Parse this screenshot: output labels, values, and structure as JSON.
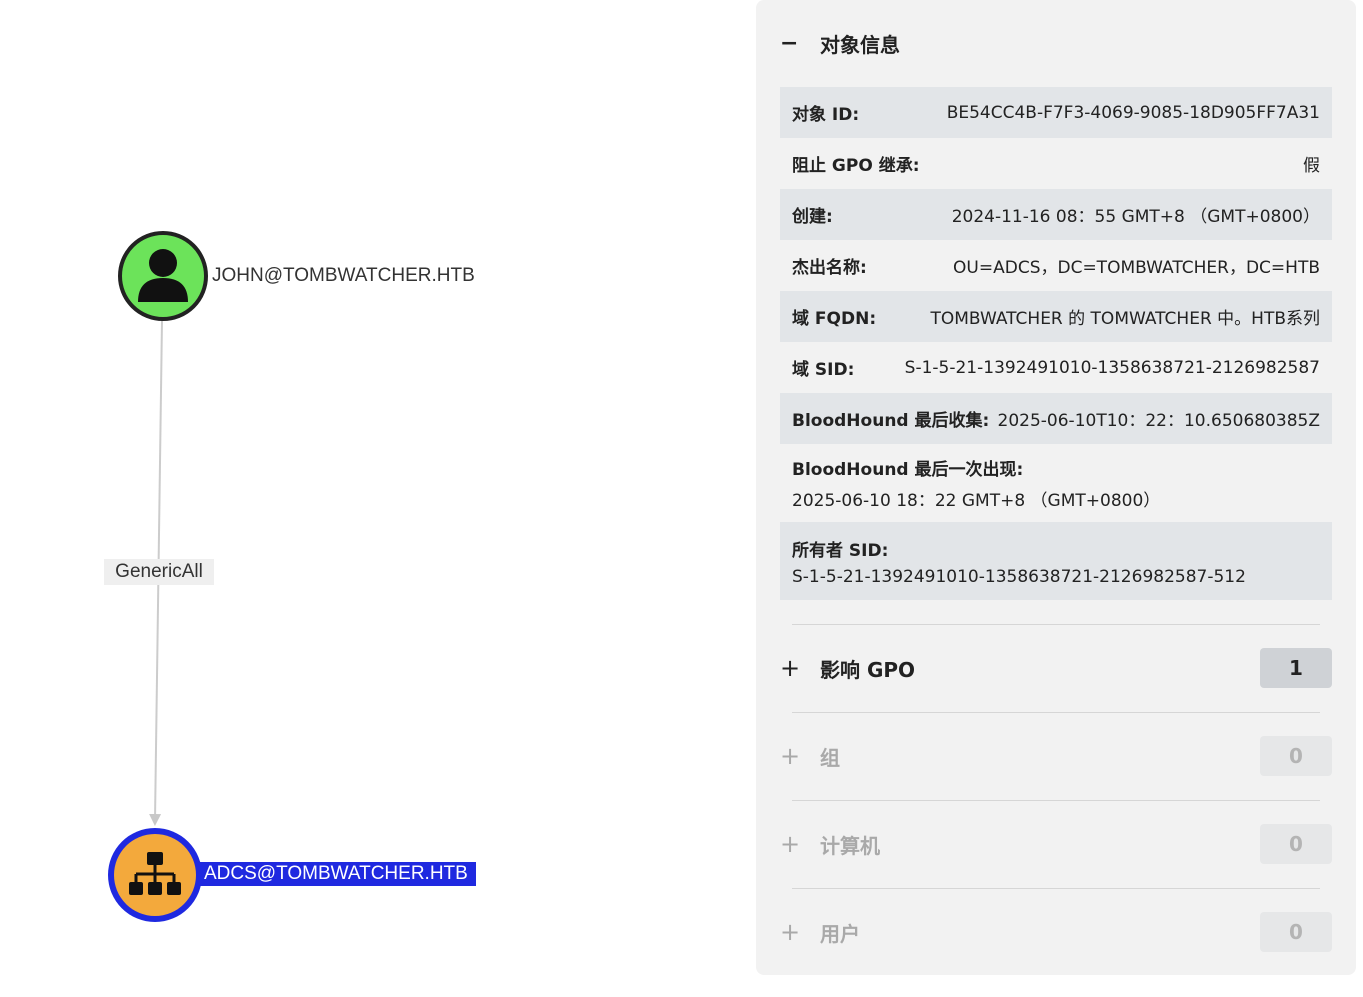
{
  "graph": {
    "source_node": {
      "label": "JOHN@TOMBWATCHER.HTB",
      "icon": "user-icon",
      "color": "#6ce35a"
    },
    "target_node": {
      "label": "ADCS@TOMBWATCHER.HTB",
      "icon": "ou-icon",
      "color": "#f3a93c",
      "ring_color": "#1f29e0"
    },
    "edge": {
      "label": "GenericAll"
    }
  },
  "panel": {
    "section_title": "对象信息",
    "collapse_icon": "minus-icon",
    "properties": [
      {
        "key": "对象 ID:",
        "value": "BE54CC4B-F7F3-4069-9085-18D905FF7A31"
      },
      {
        "key": "阻止 GPO 继承:",
        "value": "假"
      },
      {
        "key": "创建:",
        "value": "2024-11-16 08：55 GMT+8 （GMT+0800）"
      },
      {
        "key": "杰出名称:",
        "value": "OU=ADCS，DC=TOMBWATCHER，DC=HTB"
      },
      {
        "key": "域 FQDN:",
        "value": "TOMBWATCHER 的 TOMWATCHER 中。HTB系列"
      },
      {
        "key": "域 SID:",
        "value": "S-1-5-21-1392491010-1358638721-2126982587"
      },
      {
        "key": "BloodHound 最后收集:",
        "value": "2025-06-10T10：22：10.650680385Z"
      },
      {
        "key": "BloodHound 最后一次出现:",
        "value": "2025-06-10 18：22 GMT+8 （GMT+0800）"
      },
      {
        "key": "所有者 SID:",
        "value": "S-1-5-21-1392491010-1358638721-2126982587-512"
      }
    ],
    "expandables": [
      {
        "label": "影响 GPO",
        "count": "1"
      },
      {
        "label": "组",
        "count": "0"
      },
      {
        "label": "计算机",
        "count": "0"
      },
      {
        "label": "用户",
        "count": "0"
      }
    ]
  }
}
